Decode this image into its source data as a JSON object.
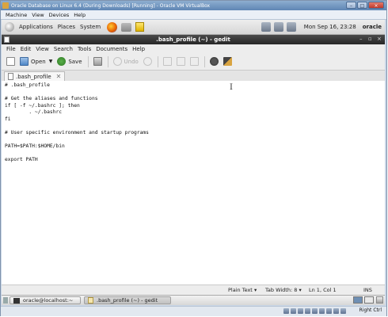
{
  "vbox": {
    "window_title": "Oracle Database on Linux 6.4 (During Downloads) [Running] - Oracle VM VirtualBox",
    "menu": [
      "Machine",
      "View",
      "Devices",
      "Help"
    ],
    "host_key": "Right Ctrl"
  },
  "gnome_panel": {
    "menus": [
      "Applications",
      "Places",
      "System"
    ],
    "clock": "Mon Sep 16, 23:28",
    "user": "oracle"
  },
  "gedit": {
    "title": ".bash_profile (~) - gedit",
    "controls": {
      "minimize": "–",
      "maximize": "▫",
      "close": "×"
    },
    "menu": [
      "File",
      "Edit",
      "View",
      "Search",
      "Tools",
      "Documents",
      "Help"
    ],
    "toolbar": {
      "open_label": "Open",
      "save_label": "Save",
      "undo_label": "Undo"
    },
    "tab": {
      "label": ".bash_profile",
      "close": "✕"
    },
    "content": "# .bash_profile\n\n# Get the aliases and functions\nif [ -f ~/.bashrc ]; then\n        . ~/.bashrc\nfi\n\n# User specific environment and startup programs\n\nPATH=$PATH:$HOME/bin\n\nexport PATH",
    "cursor_glyph": "I",
    "status": {
      "language": "Plain Text",
      "tab_width": "Tab Width: 8",
      "position": "Ln 1, Col 1",
      "mode": "INS"
    }
  },
  "taskbar": {
    "tasks": [
      {
        "label": "oracle@localhost:~"
      },
      {
        "label": ".bash_profile (~) - gedit"
      }
    ]
  },
  "colors": {
    "gedit_titlebar": "#262626",
    "gnome_panel": "#dedede",
    "vbox_frame": "#c9d6e6"
  }
}
